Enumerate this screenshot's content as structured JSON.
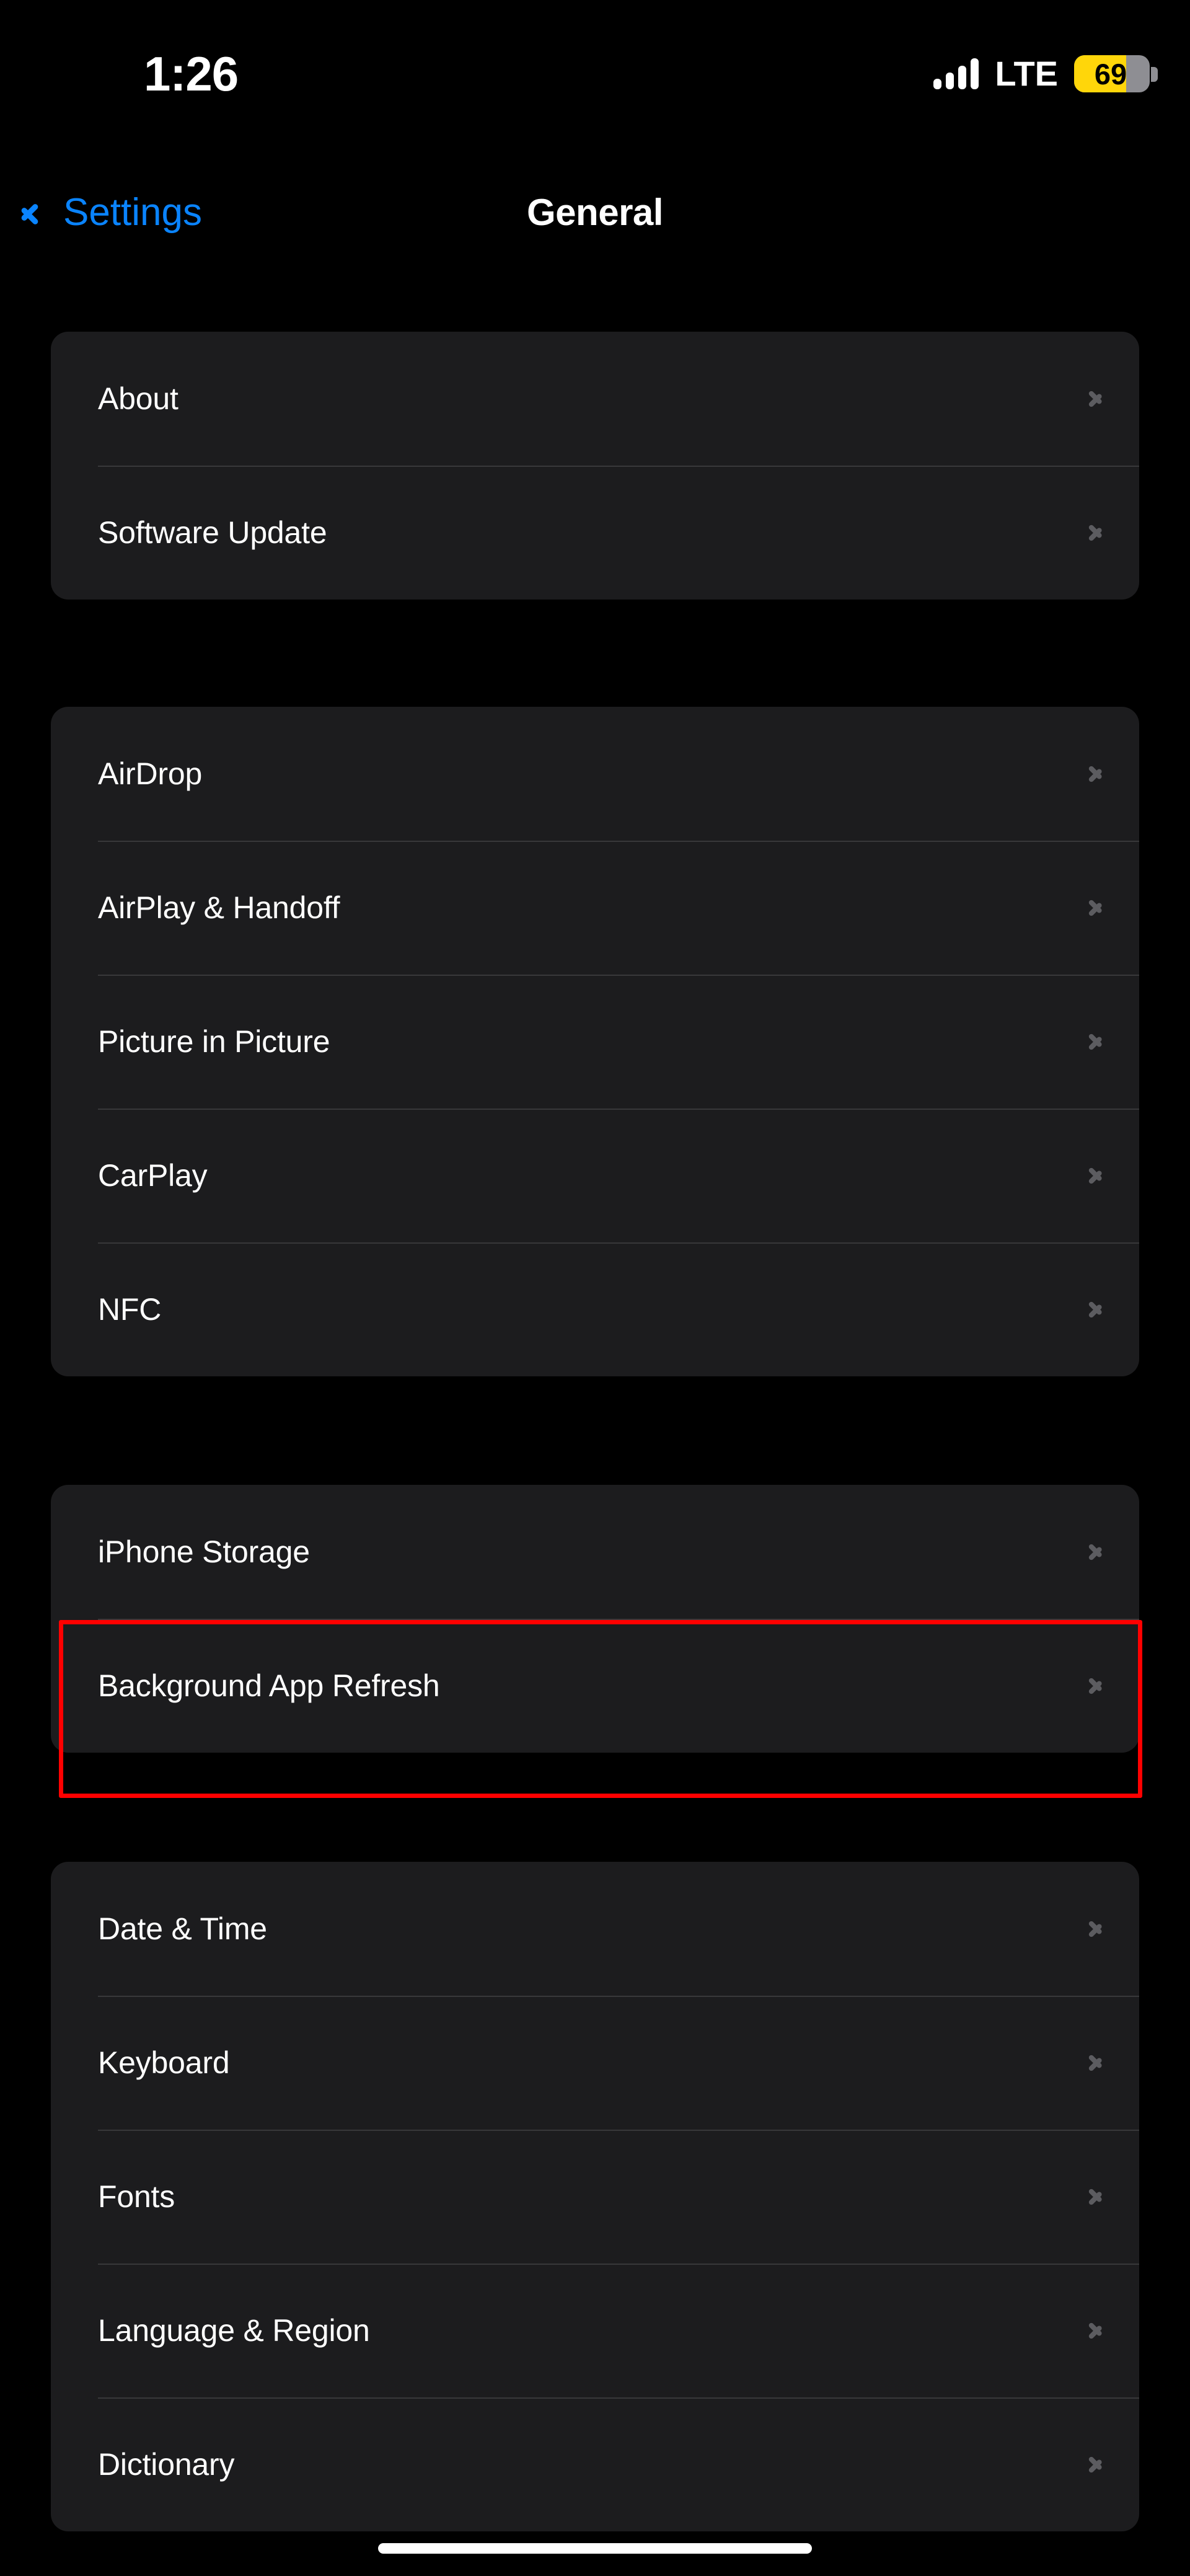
{
  "status_bar": {
    "time": "1:26",
    "carrier": "LTE",
    "battery_percent": "69",
    "battery_level": 69,
    "battery_color": "#ffd60a",
    "signal_bars": 4,
    "signal_icon": "cellular-signal-icon",
    "battery_icon": "battery-icon"
  },
  "nav_bar": {
    "back_label": "Settings",
    "back_icon": "chevron-left-icon",
    "title": "General"
  },
  "colors": {
    "page_background": "#000000",
    "card_background": "#1c1c1e",
    "separator": "#38383a",
    "primary_text": "#ffffff",
    "accent_blue": "#0a84ff",
    "chevron_gray": "#5c5c60",
    "annotation_red": "#ff0000"
  },
  "groups": [
    {
      "id": "group-0",
      "rows": [
        {
          "label": "About",
          "chevron": "chevron-right-icon"
        },
        {
          "label": "Software Update",
          "chevron": "chevron-right-icon"
        }
      ]
    },
    {
      "id": "group-1",
      "rows": [
        {
          "label": "AirDrop",
          "chevron": "chevron-right-icon"
        },
        {
          "label": "AirPlay & Handoff",
          "chevron": "chevron-right-icon"
        },
        {
          "label": "Picture in Picture",
          "chevron": "chevron-right-icon"
        },
        {
          "label": "CarPlay",
          "chevron": "chevron-right-icon"
        },
        {
          "label": "NFC",
          "chevron": "chevron-right-icon"
        }
      ]
    },
    {
      "id": "group-2",
      "rows": [
        {
          "label": "iPhone Storage",
          "chevron": "chevron-right-icon"
        },
        {
          "label": "Background App Refresh",
          "chevron": "chevron-right-icon",
          "highlighted": true
        }
      ]
    },
    {
      "id": "group-3",
      "rows": [
        {
          "label": "Date & Time",
          "chevron": "chevron-right-icon"
        },
        {
          "label": "Keyboard",
          "chevron": "chevron-right-icon"
        },
        {
          "label": "Fonts",
          "chevron": "chevron-right-icon"
        },
        {
          "label": "Language & Region",
          "chevron": "chevron-right-icon"
        },
        {
          "label": "Dictionary",
          "chevron": "chevron-right-icon"
        }
      ]
    }
  ],
  "annotation": {
    "target_label": "Background App Refresh",
    "color": "#ff0000"
  },
  "home_indicator": {
    "visible": true
  }
}
